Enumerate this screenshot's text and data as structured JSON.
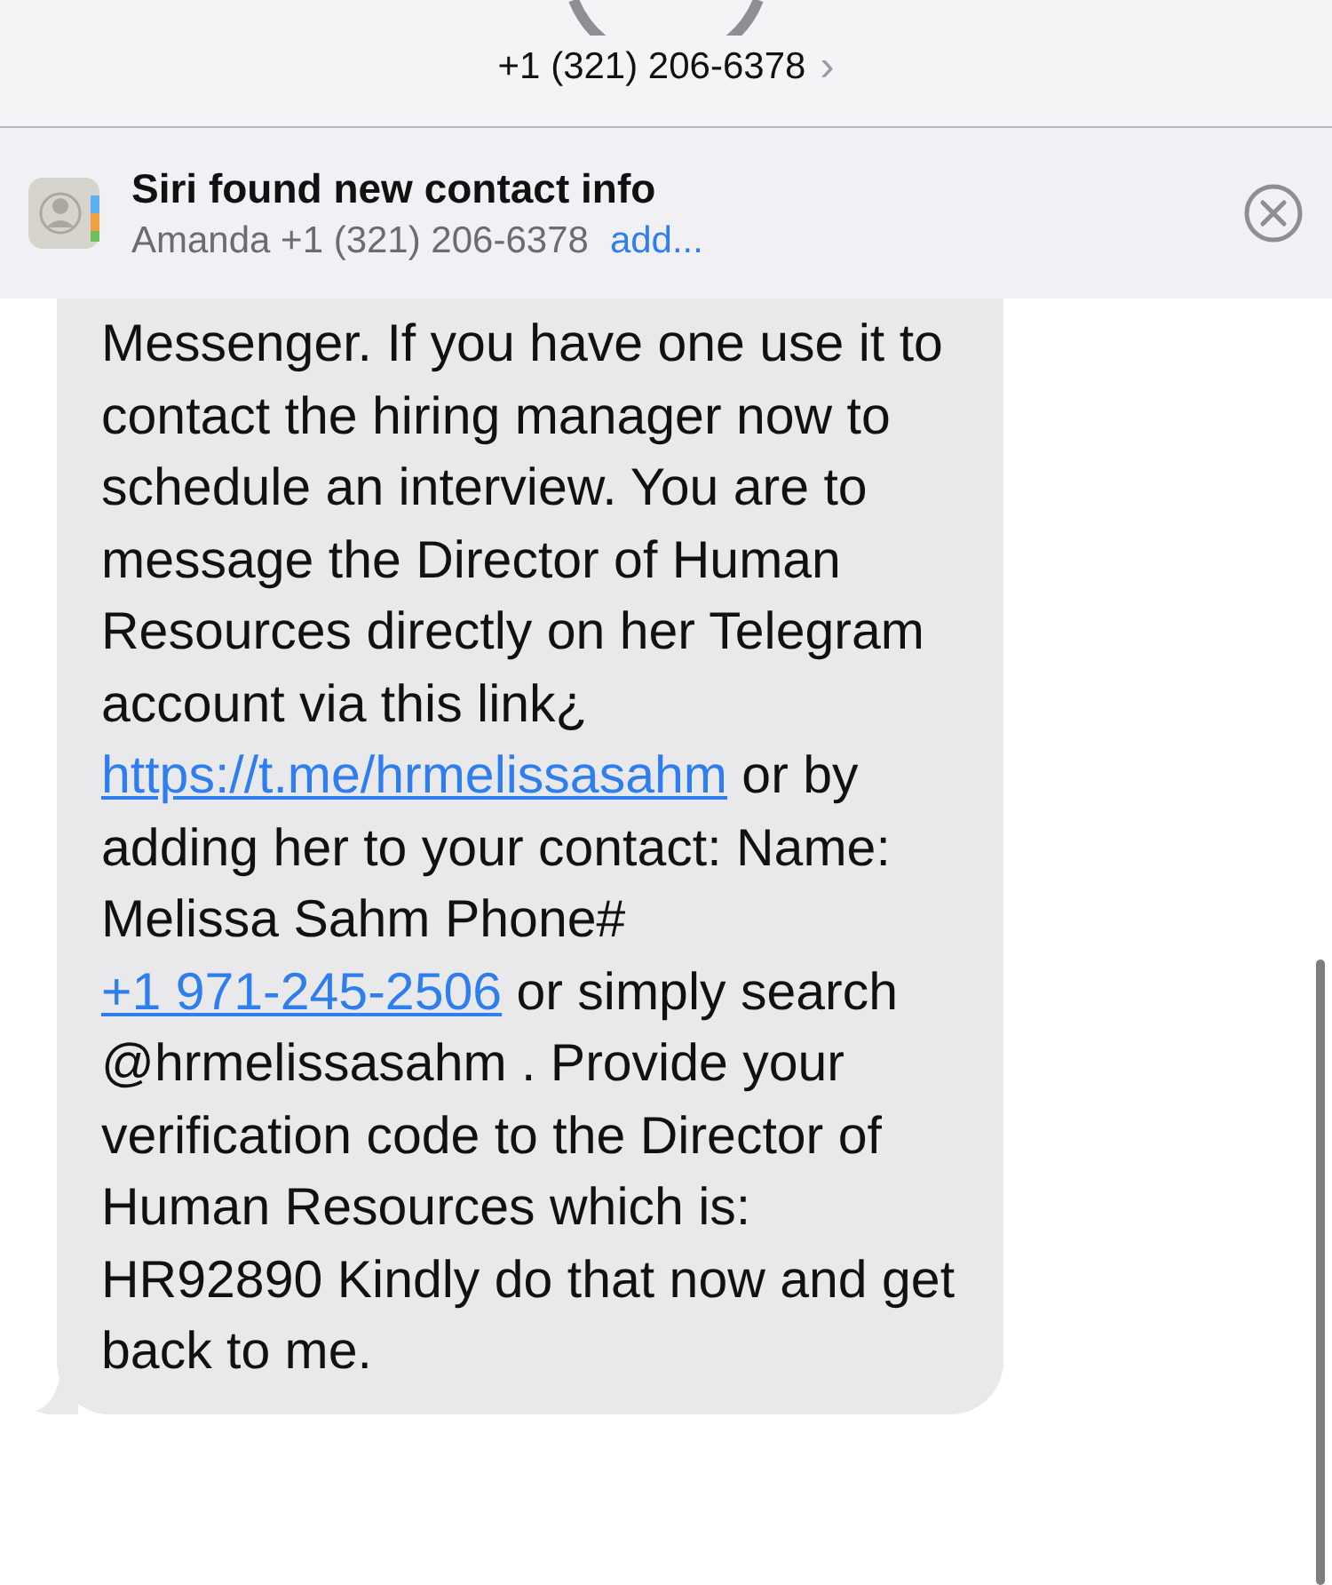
{
  "header": {
    "phone": "+1 (321) 206-6378",
    "chevron": "›"
  },
  "banner": {
    "title": "Siri found new contact info",
    "detail": "Amanda +1 (321) 206-6378",
    "action": "add..."
  },
  "message": {
    "segments": [
      {
        "kind": "text",
        "text": "Messenger. If you have one use it to contact the hiring manager now to schedule an interview. You are to message the Director of Human Resources directly on her Telegram account via this link¿ "
      },
      {
        "kind": "link",
        "text": "https://t.me/hrmelissasahm"
      },
      {
        "kind": "text",
        "text": " or by adding her to your contact: Name: Melissa Sahm Phone# "
      },
      {
        "kind": "link",
        "text": "+1 971-245-2506"
      },
      {
        "kind": "text",
        "text": " or simply search @hrmelissasahm . Provide your verification code to the Director of Human Resources which is: HR92890 Kindly do that now and get back to me."
      }
    ]
  }
}
